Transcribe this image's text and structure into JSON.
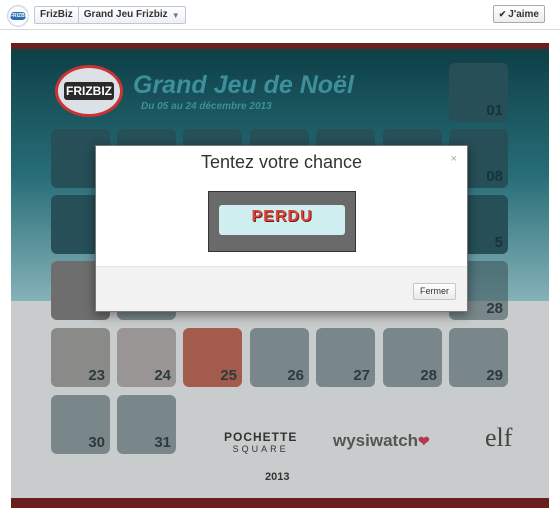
{
  "topbar": {
    "page_logo_text": "FRIZBIZ",
    "crumb_page": "FrizBiz",
    "crumb_app": "Grand Jeu Frizbiz",
    "like_label": "J'aime"
  },
  "game": {
    "logo_text": "FRIZBIZ",
    "title": "Grand Jeu de Noël",
    "dates": "Du 05 au 24 décembre 2013",
    "tiles": {
      "t01": "01",
      "t08": "08",
      "t15": "5",
      "t22": "28",
      "t23": "23",
      "t24": "24",
      "t25": "25",
      "t26": "26",
      "t27": "27",
      "t28": "28",
      "t29": "29",
      "t30": "30",
      "t31": "31"
    },
    "sponsor_pochette_line1": "POCHETTE",
    "sponsor_pochette_line2": "SQUARE",
    "sponsor_wysiwatch": "wysiwatch",
    "sponsor_elf": "elf",
    "year": "2013"
  },
  "modal": {
    "title": "Tentez votre chance",
    "close": "×",
    "result_text": "PERDU",
    "close_button": "Fermer"
  }
}
